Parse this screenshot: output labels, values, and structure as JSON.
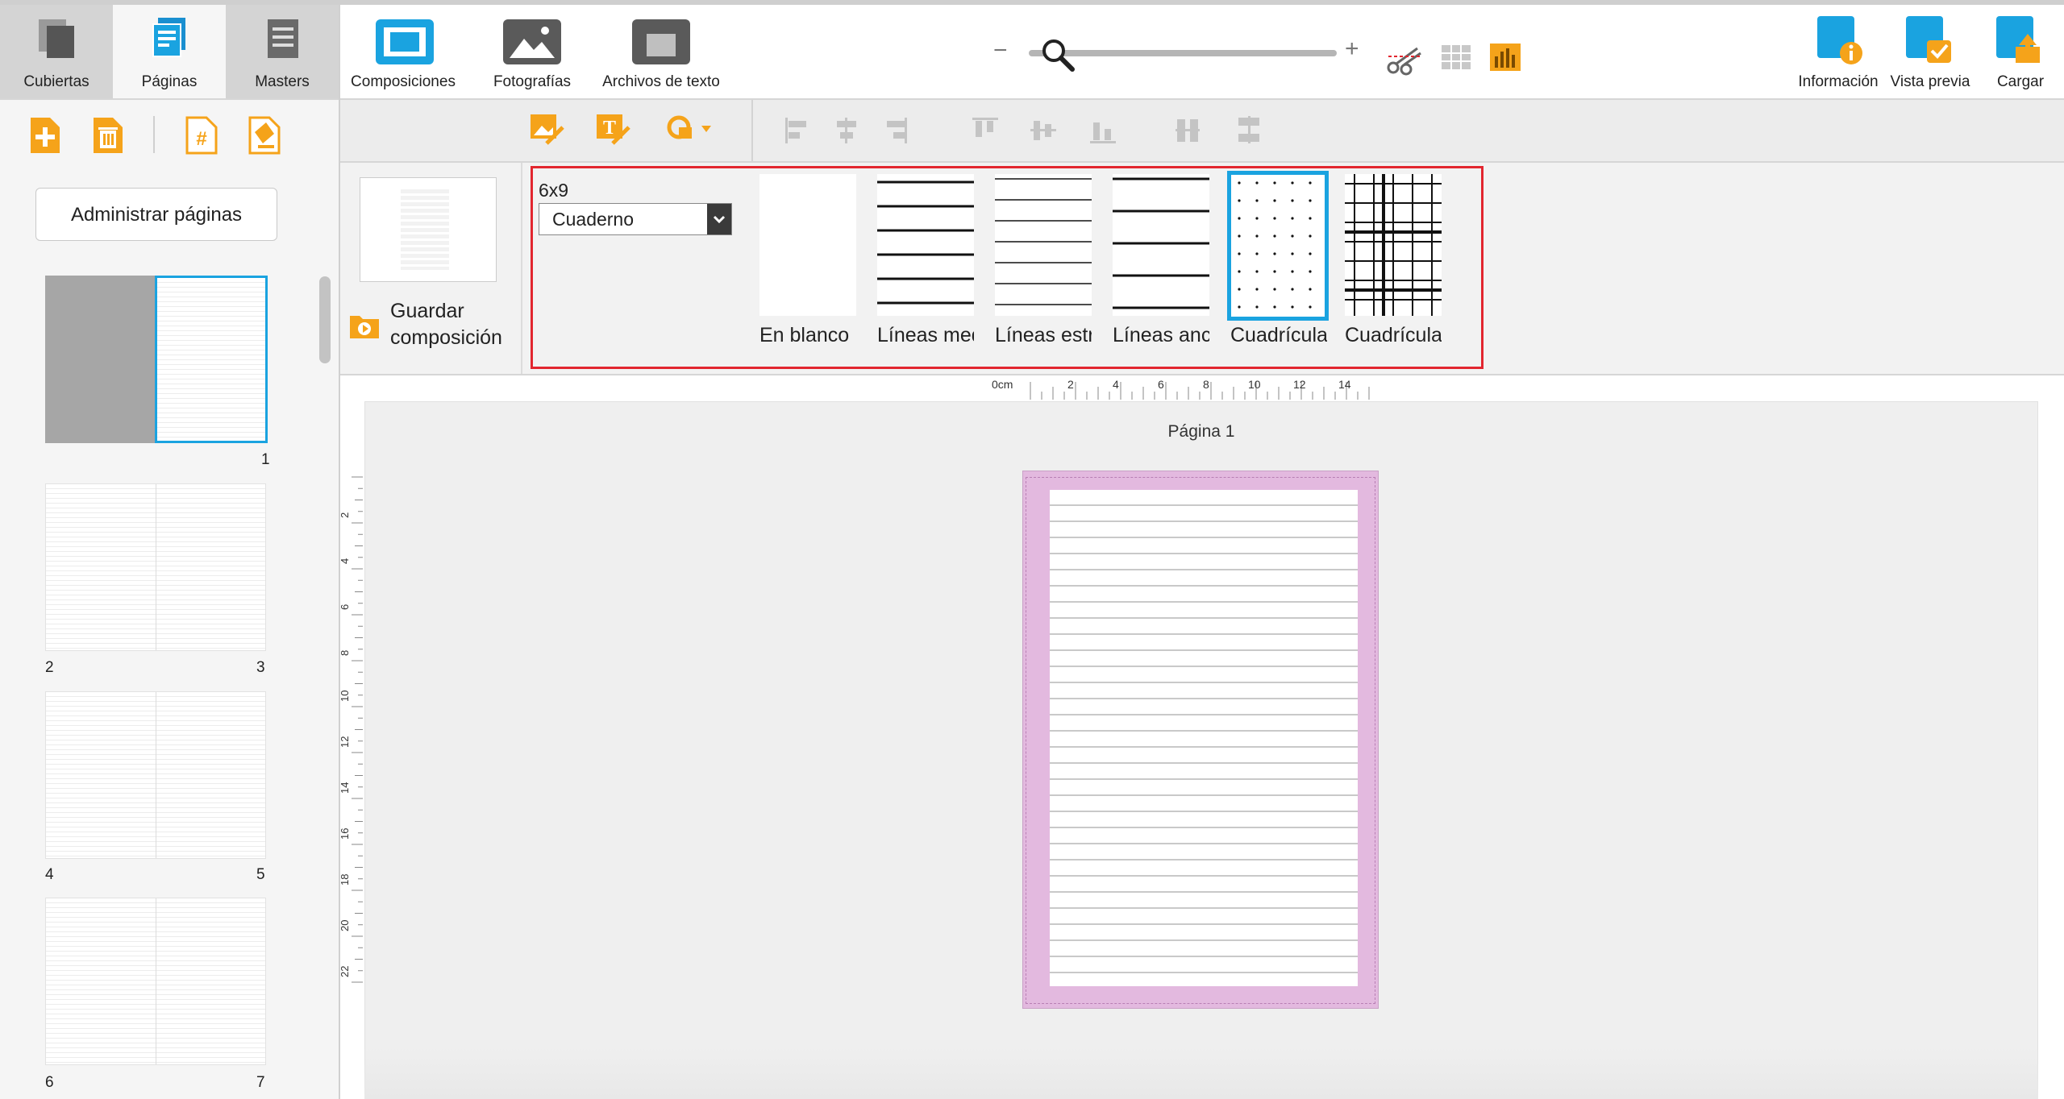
{
  "tabs": {
    "covers": "Cubiertas",
    "pages": "Páginas",
    "masters": "Masters"
  },
  "toolbar": {
    "layouts": "Composiciones",
    "photos": "Fotografías",
    "text_files": "Archivos de texto",
    "zoom_minus": "−",
    "zoom_plus": "+",
    "zoom_level": 0.05,
    "info": "Información",
    "preview": "Vista previa",
    "upload": "Cargar"
  },
  "sidebar": {
    "manage_pages": "Administrar páginas",
    "page_numbers": [
      "1",
      "2",
      "3",
      "4",
      "5",
      "6",
      "7"
    ]
  },
  "layout_panel": {
    "save_layout": "Guardar composición",
    "size": "6x9",
    "category": "Cuaderno",
    "templates": [
      {
        "label": "En blanco"
      },
      {
        "label": "Líneas medianas"
      },
      {
        "label": "Líneas estrechas"
      },
      {
        "label": "Líneas anchas"
      },
      {
        "label": "Cuadrícula de puntos",
        "selected": true
      },
      {
        "label": "Cuadrícula"
      }
    ]
  },
  "canvas": {
    "page_title": "Página 1",
    "ruler_unit": "0cm",
    "ruler_top_ticks": [
      "2",
      "4",
      "6",
      "8",
      "10",
      "12",
      "14"
    ],
    "ruler_left_ticks": [
      "2",
      "4",
      "6",
      "8",
      "10",
      "12",
      "14",
      "16",
      "18",
      "20",
      "22"
    ]
  },
  "colors": {
    "accent_orange": "#f5a31a",
    "accent_blue": "#1aa3e0",
    "selection_red": "#e2262f",
    "bleed_pink": "#e3b9df"
  }
}
